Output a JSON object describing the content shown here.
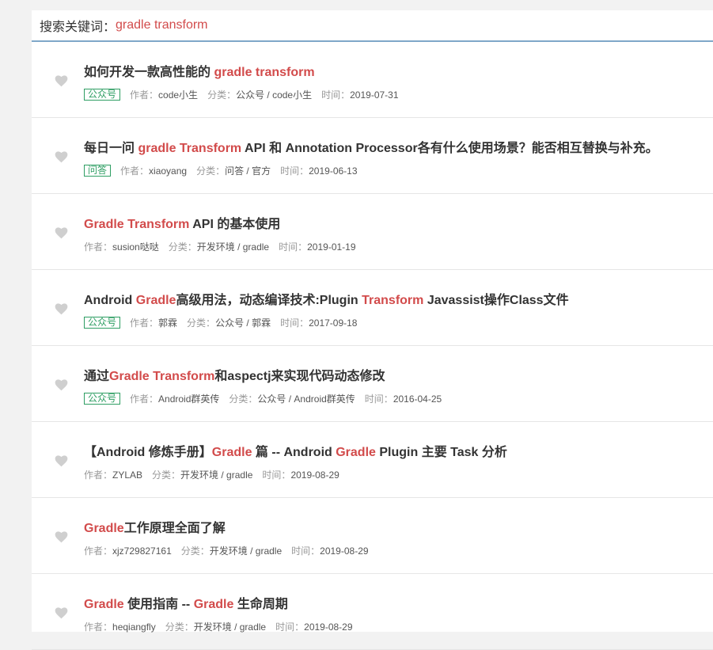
{
  "search": {
    "label": "搜索关键词：",
    "query": "gradle transform"
  },
  "meta_labels": {
    "author": "作者：",
    "category": "分类：",
    "time": "时间："
  },
  "results": [
    {
      "title_parts": [
        {
          "text": "如何开发一款高性能的 ",
          "hl": false
        },
        {
          "text": "gradle transform",
          "hl": true
        }
      ],
      "badge": "公众号",
      "author": "code小生",
      "category": "公众号 / code小生",
      "time": "2019-07-31"
    },
    {
      "title_parts": [
        {
          "text": "每日一问 ",
          "hl": false
        },
        {
          "text": "gradle Transform",
          "hl": true
        },
        {
          "text": " API 和 Annotation Processor各有什么使用场景？能否相互替换与补充。",
          "hl": false
        }
      ],
      "badge": "问答",
      "author": "xiaoyang",
      "category": "问答 / 官方",
      "time": "2019-06-13"
    },
    {
      "title_parts": [
        {
          "text": "Gradle Transform",
          "hl": true
        },
        {
          "text": " API 的基本使用",
          "hl": false
        }
      ],
      "badge": "",
      "author": "susion哒哒",
      "category": "开发环境 / gradle",
      "time": "2019-01-19"
    },
    {
      "title_parts": [
        {
          "text": "Android ",
          "hl": false
        },
        {
          "text": "Gradle",
          "hl": true
        },
        {
          "text": "高级用法，动态编译技术:Plugin ",
          "hl": false
        },
        {
          "text": "Transform",
          "hl": true
        },
        {
          "text": " Javassist操作Class文件",
          "hl": false
        }
      ],
      "badge": "公众号",
      "author": "郭霖",
      "category": "公众号 / 郭霖",
      "time": "2017-09-18"
    },
    {
      "title_parts": [
        {
          "text": "通过",
          "hl": false
        },
        {
          "text": "Gradle Transform",
          "hl": true
        },
        {
          "text": "和aspectj来实现代码动态修改",
          "hl": false
        }
      ],
      "badge": "公众号",
      "author": "Android群英传",
      "category": "公众号 / Android群英传",
      "time": "2016-04-25"
    },
    {
      "title_parts": [
        {
          "text": "【Android 修炼手册】",
          "hl": false
        },
        {
          "text": "Gradle",
          "hl": true
        },
        {
          "text": " 篇 -- Android ",
          "hl": false
        },
        {
          "text": "Gradle",
          "hl": true
        },
        {
          "text": " Plugin 主要 Task 分析",
          "hl": false
        }
      ],
      "badge": "",
      "author": "ZYLAB",
      "category": "开发环境 / gradle",
      "time": "2019-08-29"
    },
    {
      "title_parts": [
        {
          "text": "Gradle",
          "hl": true
        },
        {
          "text": "工作原理全面了解",
          "hl": false
        }
      ],
      "badge": "",
      "author": "xjz729827161",
      "category": "开发环境 / gradle",
      "time": "2019-08-29"
    },
    {
      "title_parts": [
        {
          "text": "Gradle",
          "hl": true
        },
        {
          "text": " 使用指南 -- ",
          "hl": false
        },
        {
          "text": "Gradle",
          "hl": true
        },
        {
          "text": " 生命周期",
          "hl": false
        }
      ],
      "badge": "",
      "author": "heqiangfly",
      "category": "开发环境 / gradle",
      "time": "2019-08-29"
    }
  ],
  "colors": {
    "highlight": "#d24b4b",
    "badge": "#2e9e63",
    "heart": "#cfcfcf"
  },
  "icons": {
    "favorite": "heart-icon"
  }
}
